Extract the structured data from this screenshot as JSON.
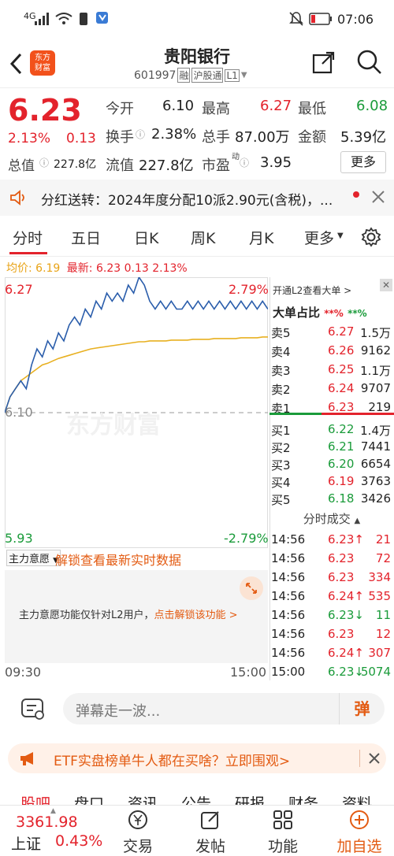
{
  "status": {
    "network": "4G",
    "time": "07:06"
  },
  "header": {
    "logo": "东方\n财富",
    "title": "贵阳银行",
    "code": "601997",
    "tags": [
      "融",
      "沪股通",
      "L1"
    ]
  },
  "quote": {
    "price": "6.23",
    "change_pct": "2.13%",
    "change": "0.13",
    "open_label": "今开",
    "open": "6.10",
    "high_label": "最高",
    "high": "6.27",
    "low_label": "最低",
    "low": "6.08",
    "turnover_label": "换手",
    "turnover": "2.38%",
    "volume_label": "总手",
    "volume": "87.00万",
    "amount_label": "金额",
    "amount": "5.39亿",
    "mcap_label": "总值",
    "mcap": "227.8亿",
    "float_label": "流值",
    "float": "227.8亿",
    "pe_label": "市盈",
    "pe_sup": "动",
    "pe": "3.95",
    "more": "更多"
  },
  "notice": {
    "text": "分红送转：2024年度分配10派2.90元(含税)，..."
  },
  "tabs": [
    "分时",
    "五日",
    "日K",
    "周K",
    "月K",
    "更多"
  ],
  "chart": {
    "avg_label": "均价:",
    "avg": "6.19",
    "latest_label": "最新:",
    "latest": "6.23",
    "latest_chg": "0.13",
    "latest_pct": "2.13%",
    "y_top": "6.27",
    "y_top_pct": "2.79%",
    "y_mid": "6.10",
    "y_bottom": "5.93",
    "y_bottom_pct": "-2.79%",
    "watermark": "东方财富",
    "x_start": "09:30",
    "x_end": "15:00",
    "indicator_select": "主力意愿",
    "unlock_text": "解锁查看最新实时数据",
    "l2_text": "主力意愿功能仅针对L2用户，",
    "l2_link": "点击解锁该功能 >"
  },
  "chart_data": {
    "type": "line",
    "title": "",
    "x_range": [
      "09:30",
      "15:00"
    ],
    "ylim": [
      5.93,
      6.27
    ],
    "base": 6.1,
    "series": [
      {
        "name": "最新",
        "values": [
          6.1,
          6.12,
          6.13,
          6.14,
          6.13,
          6.16,
          6.18,
          6.17,
          6.19,
          6.18,
          6.2,
          6.19,
          6.21,
          6.22,
          6.21,
          6.23,
          6.22,
          6.24,
          6.23,
          6.25,
          6.24,
          6.25,
          6.24,
          6.26,
          6.25,
          6.27,
          6.26,
          6.24,
          6.23,
          6.24,
          6.23,
          6.24,
          6.23,
          6.23,
          6.24,
          6.23,
          6.24,
          6.23,
          6.24,
          6.23,
          6.24,
          6.23,
          6.24,
          6.23,
          6.24,
          6.23,
          6.24,
          6.23,
          6.24,
          6.23
        ]
      },
      {
        "name": "均价",
        "values": [
          6.1,
          6.12,
          6.13,
          6.14,
          6.145,
          6.15,
          6.155,
          6.16,
          6.162,
          6.165,
          6.168,
          6.17,
          6.172,
          6.174,
          6.176,
          6.178,
          6.18,
          6.181,
          6.182,
          6.183,
          6.184,
          6.185,
          6.186,
          6.187,
          6.188,
          6.189,
          6.189,
          6.19,
          6.19,
          6.19,
          6.19,
          6.191,
          6.191,
          6.191,
          6.191,
          6.192,
          6.192,
          6.192,
          6.192,
          6.193,
          6.193,
          6.193,
          6.193,
          6.193,
          6.194,
          6.194,
          6.194,
          6.194,
          6.195,
          6.195
        ]
      }
    ]
  },
  "orderbook": {
    "l2_link": "开通L2查看大单 >",
    "big_label": "大单占比",
    "big_sell": "**%",
    "big_buy": "**%",
    "asks": [
      {
        "l": "卖5",
        "p": "6.27",
        "v": "1.5万"
      },
      {
        "l": "卖4",
        "p": "6.26",
        "v": "9162"
      },
      {
        "l": "卖3",
        "p": "6.25",
        "v": "1.1万"
      },
      {
        "l": "卖2",
        "p": "6.24",
        "v": "9707"
      },
      {
        "l": "卖1",
        "p": "6.23",
        "v": "219"
      }
    ],
    "bids": [
      {
        "l": "买1",
        "p": "6.22",
        "v": "1.4万"
      },
      {
        "l": "买2",
        "p": "6.21",
        "v": "7441"
      },
      {
        "l": "买3",
        "p": "6.20",
        "v": "6654"
      },
      {
        "l": "买4",
        "p": "6.19",
        "v": "3763"
      },
      {
        "l": "买5",
        "p": "6.18",
        "v": "3426"
      }
    ],
    "ticks_title": "分时成交",
    "ticks": [
      {
        "t": "14:56",
        "p": "6.23↑",
        "v": "21"
      },
      {
        "t": "14:56",
        "p": "6.23",
        "v": "72"
      },
      {
        "t": "14:56",
        "p": "6.23",
        "v": "334"
      },
      {
        "t": "14:56",
        "p": "6.24↑",
        "v": "535"
      },
      {
        "t": "14:56",
        "p": "6.23↓",
        "v": "11"
      },
      {
        "t": "14:56",
        "p": "6.23",
        "v": "12"
      },
      {
        "t": "14:56",
        "p": "6.24↑",
        "v": "307"
      },
      {
        "t": "15:00",
        "p": "6.23↓",
        "v": "5074"
      }
    ]
  },
  "comment": {
    "placeholder": "弹幕走一波...",
    "danmu": "弹"
  },
  "ad": {
    "text": "ETF实盘榜单牛人都在买啥？立即围观>"
  },
  "subtabs": [
    "股吧",
    "盘口",
    "资讯",
    "公告",
    "研报",
    "财务",
    "资料"
  ],
  "bottom": {
    "index_value": "3361.98",
    "index_name": "上证",
    "index_pct": "0.43%",
    "items": [
      "交易",
      "发帖",
      "功能",
      "加自选"
    ]
  }
}
